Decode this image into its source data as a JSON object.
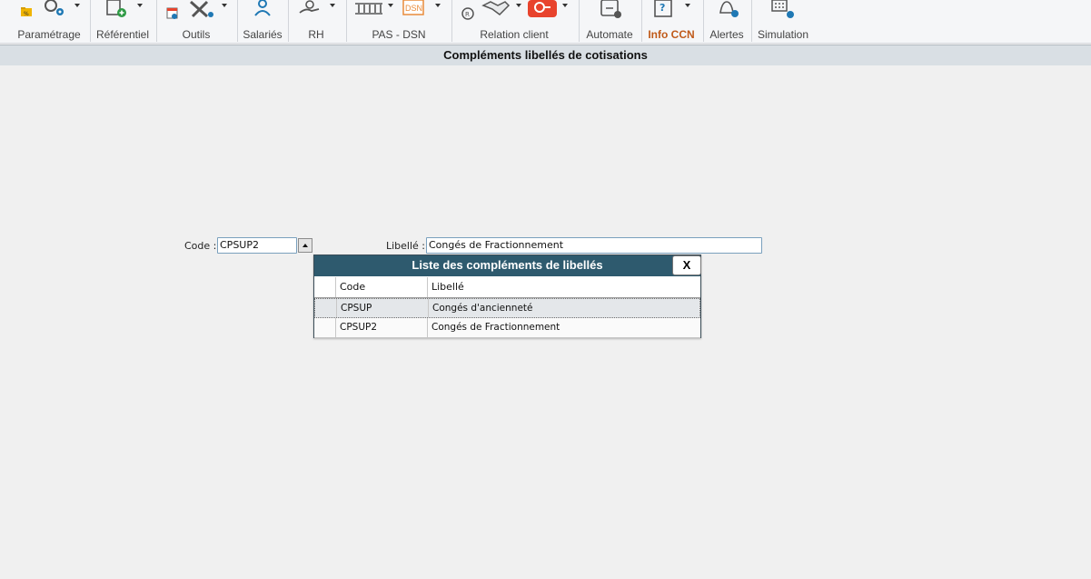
{
  "ribbon": {
    "groups": [
      {
        "label": "Paramétrage"
      },
      {
        "label": "Référentiel"
      },
      {
        "label": "Outils"
      },
      {
        "label": "Salariés"
      },
      {
        "label": "RH"
      },
      {
        "label": "PAS - DSN"
      },
      {
        "label": "Relation client"
      },
      {
        "label": "Automate"
      },
      {
        "label": "Info CCN"
      },
      {
        "label": "Alertes"
      },
      {
        "label": "Simulation"
      }
    ],
    "colors": {
      "accent": "#c05a1a",
      "icon_blue": "#1f78b4",
      "icon_gray": "#555555",
      "ae_red": "#e8432d",
      "dsn_orange": "#e98b3a",
      "green": "#2e9a45"
    }
  },
  "page": {
    "title": "Compléments libellés de cotisations"
  },
  "form": {
    "code_label": "Code :",
    "code_value": "CPSUP2",
    "libelle_label": "Libellé :",
    "libelle_value": "Congés de Fractionnement"
  },
  "popup": {
    "title": "Liste des compléments de libellés",
    "close_label": "X",
    "columns": [
      "Code",
      "Libellé"
    ],
    "rows": [
      {
        "code": "CPSUP",
        "libelle": "Congés d'ancienneté"
      },
      {
        "code": "CPSUP2",
        "libelle": "Congés de Fractionnement"
      }
    ],
    "header_color": "#2e5a6e"
  }
}
